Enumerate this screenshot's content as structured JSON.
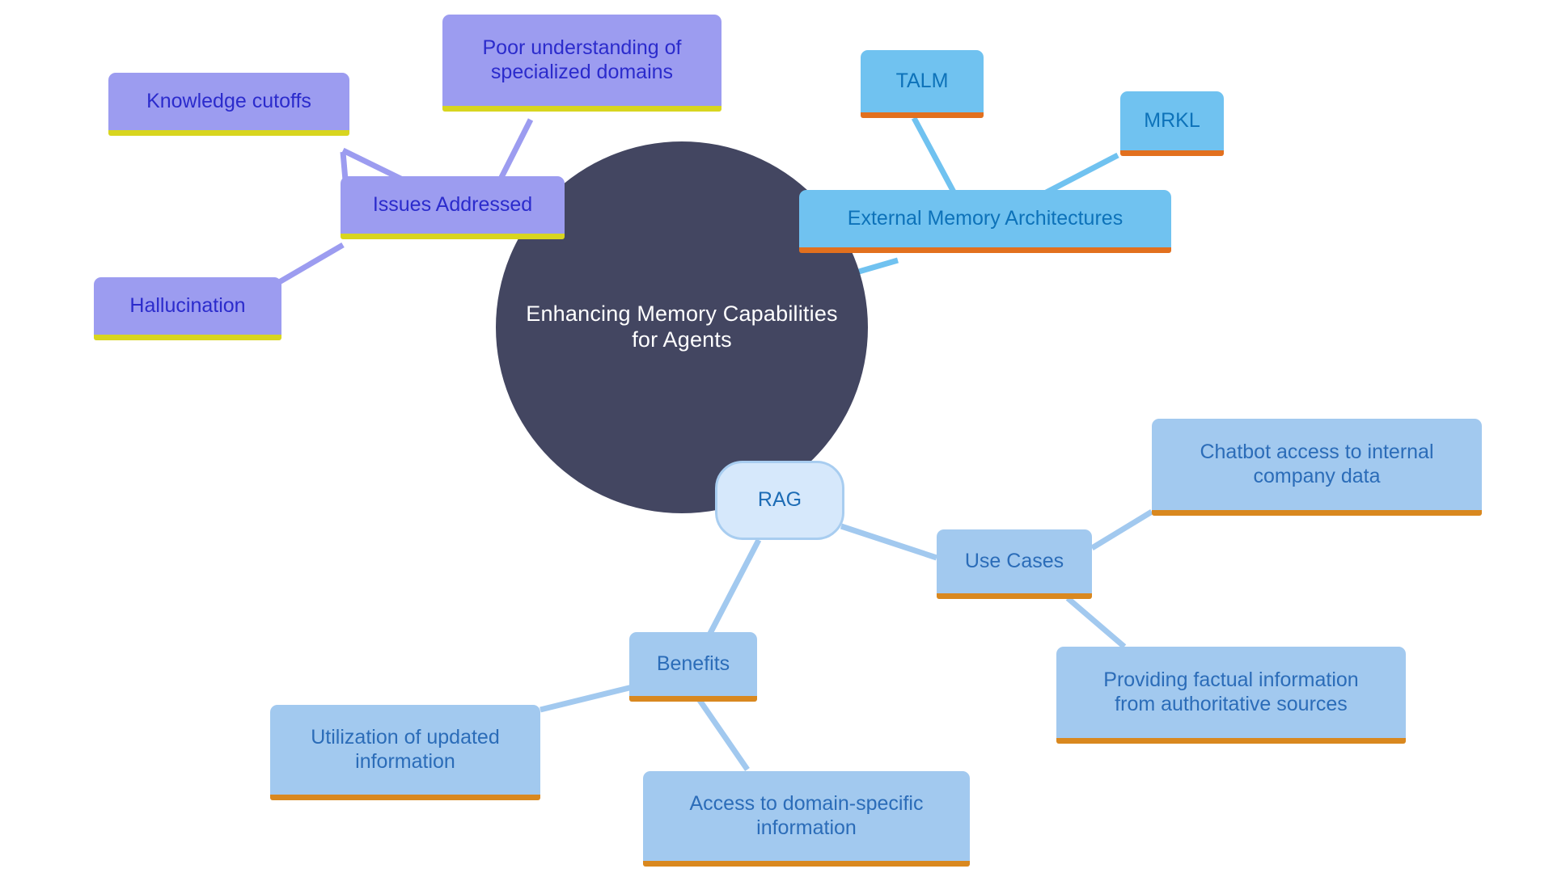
{
  "diagram": {
    "type": "mind-map",
    "background": "#ffffff",
    "root": {
      "id": "root",
      "label": "Enhancing Memory Capabilities\nfor Agents",
      "shape": "circle",
      "fill": "#434661",
      "text_color": "#ffffff"
    },
    "palettes": {
      "purple_fill": "#9c9cf0",
      "purple_text": "#2b2bcc",
      "purple_underline": "#d8d51f",
      "blue_bright_fill": "#70c2f0",
      "blue_bright_text": "#0d72b9",
      "blue_bright_underline": "#e2701e",
      "blue_soft_fill": "#a2c9ef",
      "blue_soft_text": "#2b6cb8",
      "blue_soft_underline": "#d9881f",
      "rag_fill": "#d6e8fb",
      "rag_border": "#a8cdf0",
      "rag_text": "#1d6cb5",
      "edge_purple": "#9c9cf0",
      "edge_blue_bright": "#70c2f0",
      "edge_blue_soft": "#a2c9ef"
    },
    "branches": [
      {
        "id": "issues-addressed",
        "label": "Issues Addressed",
        "style": "purple",
        "children": [
          {
            "id": "knowledge-cutoffs",
            "label": "Knowledge cutoffs",
            "style": "purple"
          },
          {
            "id": "poor-understanding",
            "label": "Poor understanding of\nspecialized domains",
            "style": "purple"
          },
          {
            "id": "hallucination",
            "label": "Hallucination",
            "style": "purple"
          }
        ]
      },
      {
        "id": "external-memory-architectures",
        "label": "External Memory Architectures",
        "style": "blue-bright",
        "children": [
          {
            "id": "talm",
            "label": "TALM",
            "style": "blue-bright"
          },
          {
            "id": "mrkl",
            "label": "MRKL",
            "style": "blue-bright"
          }
        ]
      },
      {
        "id": "rag",
        "label": "RAG",
        "style": "rag-pill",
        "children": [
          {
            "id": "use-cases",
            "label": "Use Cases",
            "style": "blue-soft",
            "children": [
              {
                "id": "chatbot-access",
                "label": "Chatbot access to internal\ncompany data",
                "style": "blue-soft"
              },
              {
                "id": "factual-info",
                "label": "Providing factual information\nfrom authoritative sources",
                "style": "blue-soft"
              }
            ]
          },
          {
            "id": "benefits",
            "label": "Benefits",
            "style": "blue-soft",
            "children": [
              {
                "id": "updated-information",
                "label": "Utilization of updated\ninformation",
                "style": "blue-soft"
              },
              {
                "id": "domain-specific",
                "label": "Access to domain-specific\ninformation",
                "style": "blue-soft"
              }
            ]
          }
        ]
      }
    ]
  }
}
